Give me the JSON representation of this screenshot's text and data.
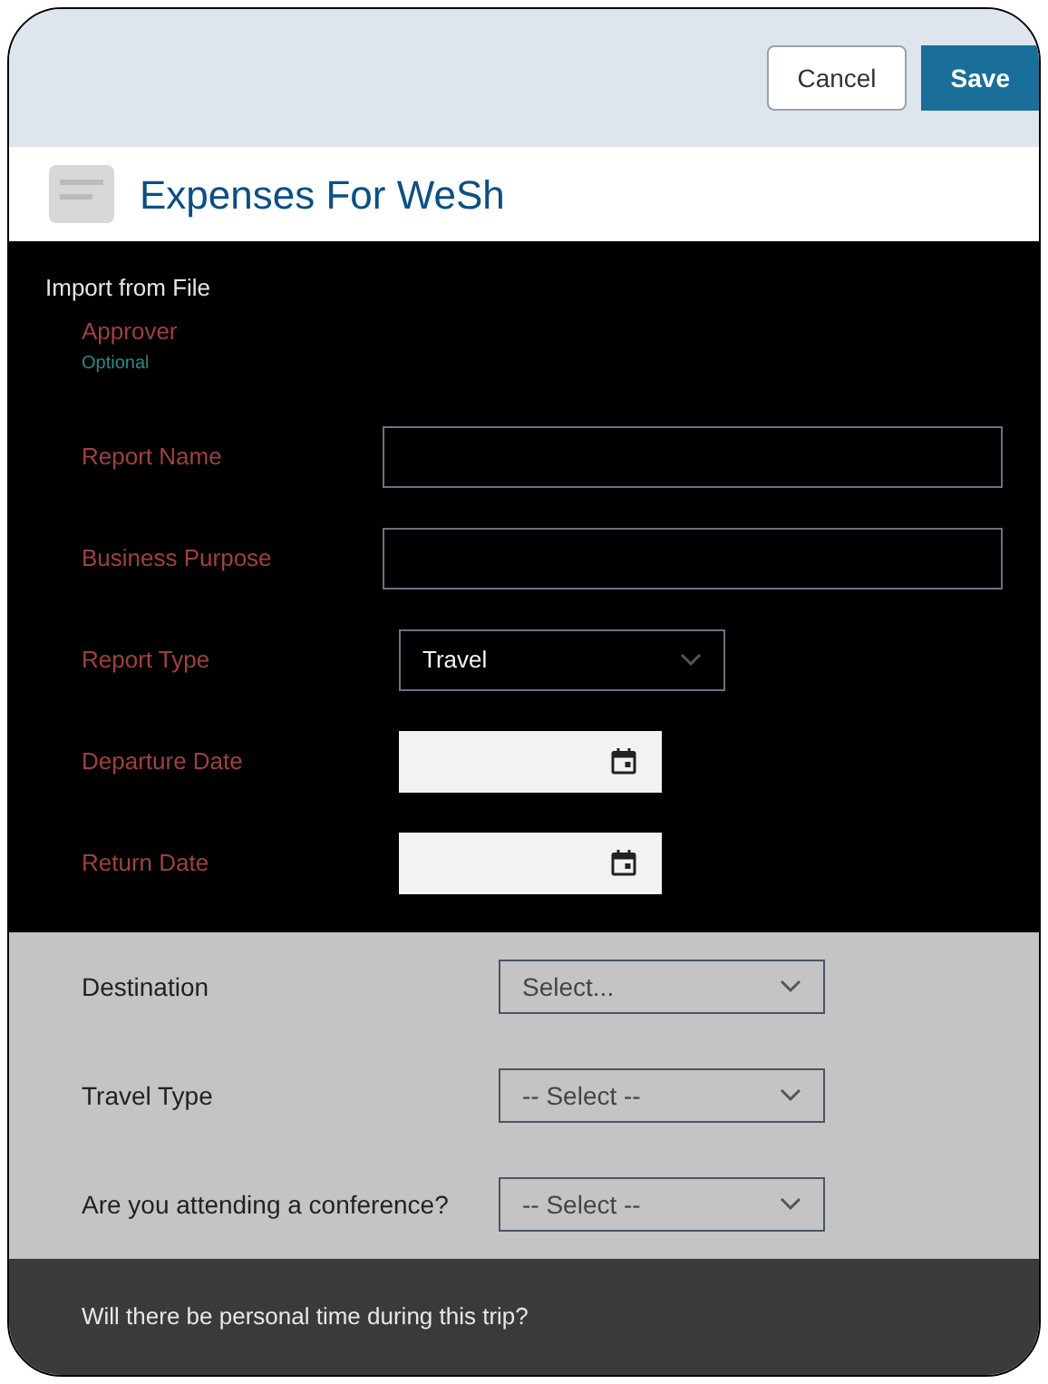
{
  "toolbar": {
    "buttons": [
      {
        "label": "Cancel",
        "kind": "secondary"
      },
      {
        "label": "Save",
        "kind": "primary"
      }
    ]
  },
  "header": {
    "title": "Expenses For WeSh"
  },
  "import": {
    "label": "Import from File"
  },
  "approver": {
    "label": "Approver",
    "hint": "Optional"
  },
  "fields": [
    {
      "label": "Report Name",
      "kind": "text"
    },
    {
      "label": "Business Purpose",
      "kind": "text"
    },
    {
      "label": "Report Type",
      "kind": "select",
      "value": "Travel"
    },
    {
      "label": "Departure Date",
      "kind": "date"
    },
    {
      "label": "Return Date",
      "kind": "date"
    }
  ],
  "travel_fields": [
    {
      "label": "Destination",
      "value": "Select..."
    },
    {
      "label": "Travel Type",
      "value": "-- Select --"
    },
    {
      "label": "Are you attending a conference?",
      "value": "-- Select --"
    }
  ],
  "personal": {
    "label": "Will there be personal time during this trip?"
  }
}
